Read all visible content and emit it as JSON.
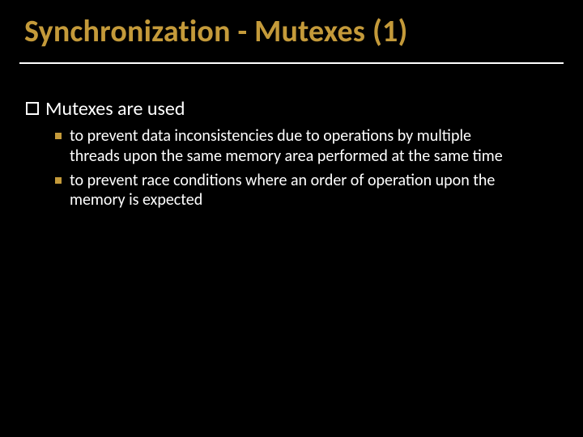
{
  "slide": {
    "title": "Synchronization - Mutexes (1)",
    "heading": "Mutexes are used",
    "bullets": [
      "to prevent data inconsistencies due to operations by multiple threads upon the same memory area performed at the same time",
      "to prevent race conditions where an order of operation upon the memory is expected"
    ]
  },
  "colors": {
    "accent": "#c49a3a",
    "background": "#000000",
    "text": "#ffffff"
  }
}
